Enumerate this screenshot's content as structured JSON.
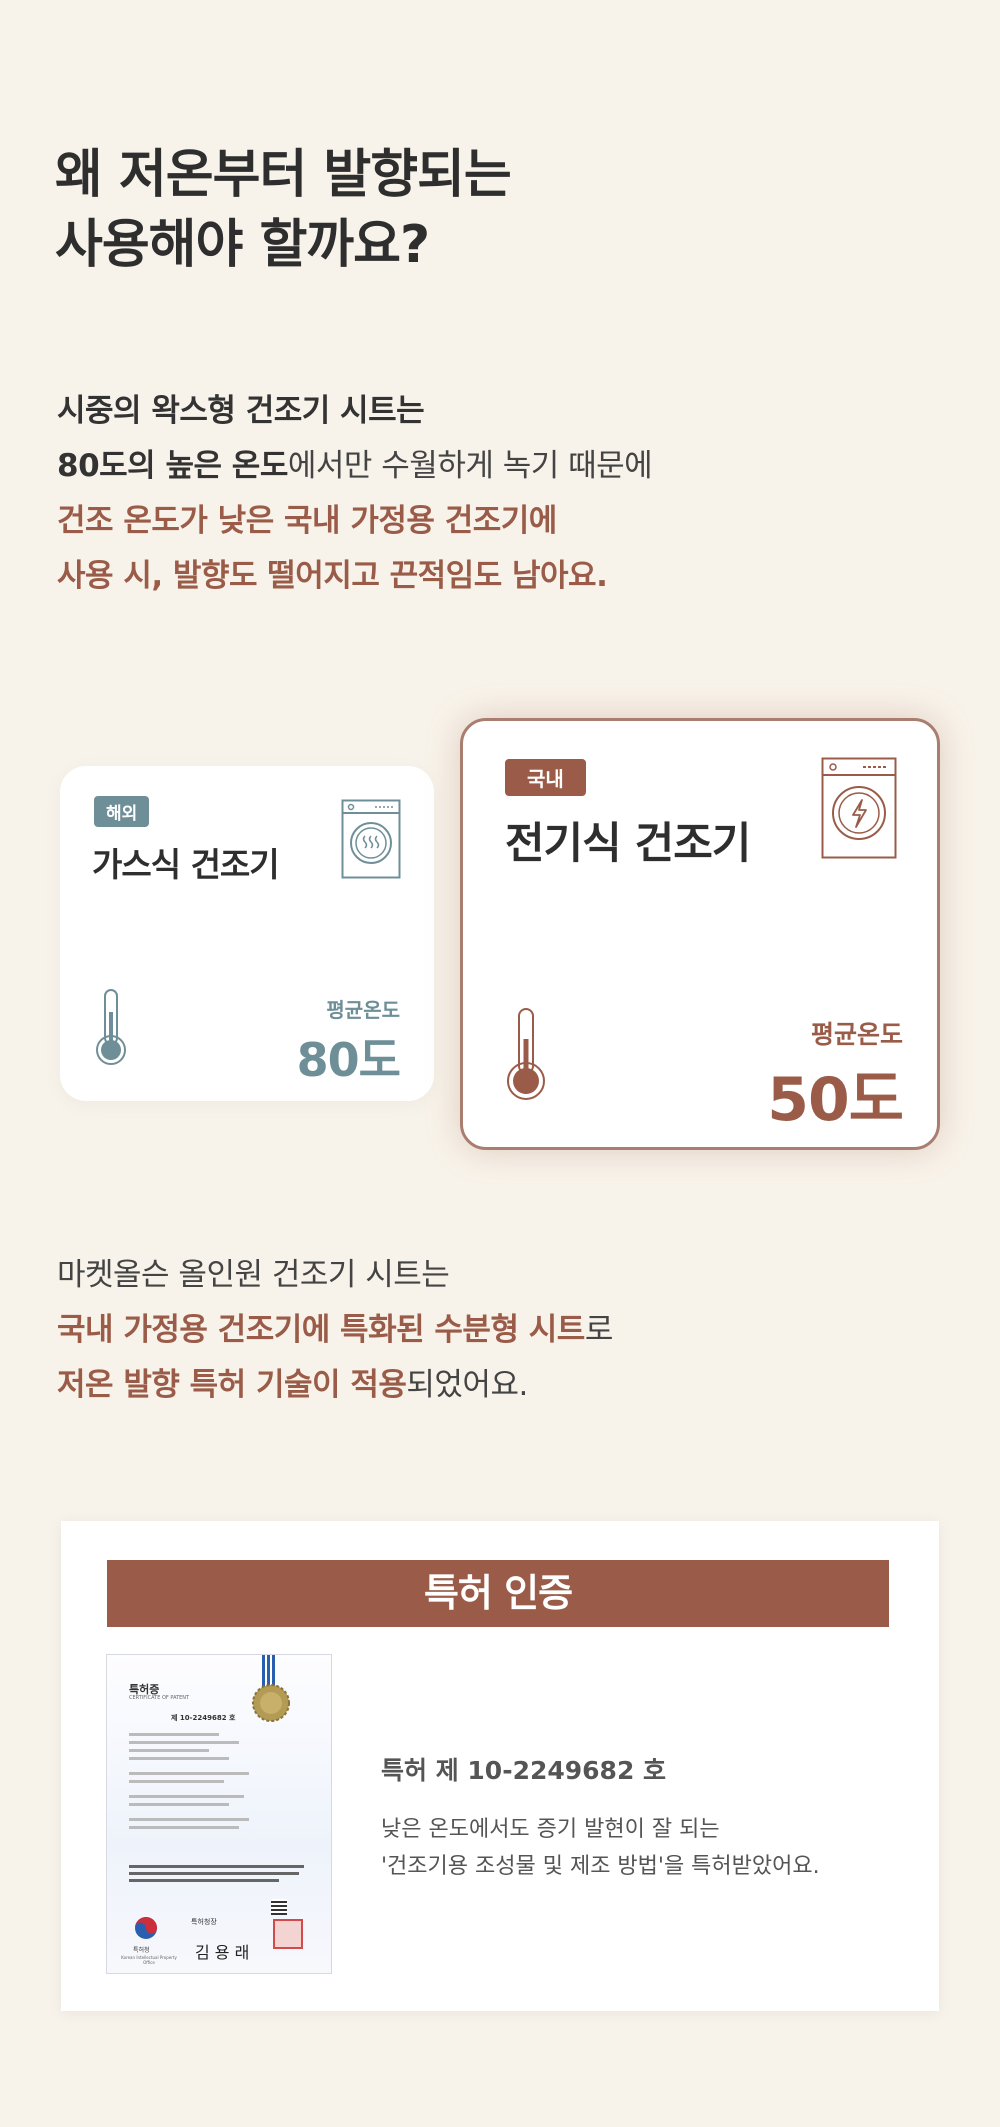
{
  "headline": [
    "왜 저온부터 발향되는",
    "사용해야 할까요?"
  ],
  "intro": {
    "line1": "시중의 왁스형 건조기 시트는",
    "line2_bold": "80도의 높은 온도",
    "line2_rest": "에서만 수월하게 녹기 때문에",
    "line3": "건조 온도가 낮은 국내 가정용 건조기에",
    "line4": "사용 시, 발향도 떨어지고 끈적임도 남아요."
  },
  "cards": {
    "foreign": {
      "badge": "해외",
      "name": "가스식 건조기",
      "temp_label": "평균온도",
      "temp_value": "80도",
      "color": "#6f8f98",
      "icon": "steam-washer-icon"
    },
    "domestic": {
      "badge": "국내",
      "name": "전기식 건조기",
      "temp_label": "평균온도",
      "temp_value": "50도",
      "color": "#9a5c48",
      "icon": "electric-washer-icon"
    }
  },
  "closing": {
    "line1": "마켓올슨 올인원 건조기 시트는",
    "line2_accent": "국내 가정용 건조기에 특화된 수분형 시트",
    "line2_rest": "로",
    "line3_accent": "저온 발향 특허 기술이 적용",
    "line3_rest": "되었어요."
  },
  "patent": {
    "header": "특허 인증",
    "number": "특허 제 10-2249682 호",
    "desc_line1": "낮은 온도에서도 증기 발현이 잘 되는",
    "desc_line2": "'건조기용 조성물 및 제조 방법'을 특허받았어요.",
    "certificate": {
      "title": "특허증",
      "subtitle": "CERTIFICATE OF PATENT",
      "number": "제 10-2249682 호",
      "office": "특허청",
      "office_en": "Korean Intellectual Property Office",
      "commissioner": "특허청장",
      "signature": "김 용 래"
    }
  }
}
